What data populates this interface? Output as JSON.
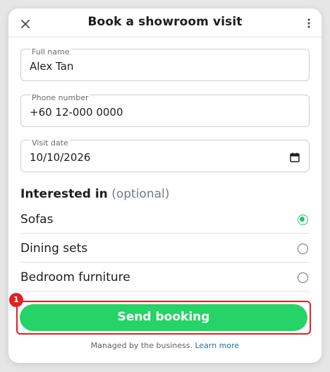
{
  "dialog": {
    "title": "Book a showroom visit"
  },
  "form": {
    "full_name": {
      "label": "Full name",
      "value": "Alex Tan"
    },
    "phone": {
      "label": "Phone number",
      "value": "+60 12-000 0000"
    },
    "visit_date": {
      "label": "Visit date",
      "value": "10/10/2026"
    }
  },
  "interests": {
    "title": "Interested in",
    "optional": "(optional)",
    "options": [
      {
        "label": "Sofas",
        "checked": true
      },
      {
        "label": "Dining sets",
        "checked": false
      },
      {
        "label": "Bedroom furniture",
        "checked": false
      }
    ]
  },
  "actions": {
    "send_label": "Send booking",
    "badge": "1"
  },
  "footer": {
    "text": "Managed by the business.",
    "link": "Learn more"
  },
  "colors": {
    "accent": "#25d366",
    "highlight": "#e32020",
    "link": "#1f6fb2"
  }
}
